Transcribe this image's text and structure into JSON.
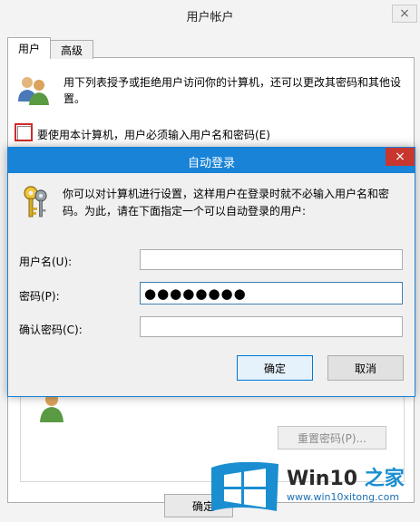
{
  "background_window": {
    "title": "用户帐户",
    "close_glyph": "×",
    "tabs": [
      {
        "label": "用户",
        "active": true
      },
      {
        "label": "高级",
        "active": false
      }
    ],
    "description": "用下列表授予或拒绝用户访问你的计算机，还可以更改其密码和其他设置。",
    "must_enter_checkbox": {
      "label": "要使用本计算机，用户必须输入用户名和密码(E)",
      "checked": false
    },
    "reset_password_label": "重置密码(P)...",
    "ok_label": "确定"
  },
  "dialog": {
    "title": "自动登录",
    "close_glyph": "×",
    "description": "你可以对计算机进行设置，这样用户在登录时就不必输入用户名和密码。为此，请在下面指定一个可以自动登录的用户:",
    "fields": {
      "username": {
        "label": "用户名(U):",
        "value": ""
      },
      "password": {
        "label": "密码(P):",
        "value": "●●●●●●●●"
      },
      "confirm": {
        "label": "确认密码(C):",
        "value": ""
      }
    },
    "ok_label": "确定",
    "cancel_label": "取消"
  },
  "watermark": {
    "brand_prefix": "Win10 ",
    "brand_suffix": "之家",
    "url": "www.win10xitong.com"
  },
  "colors": {
    "dialog_accent": "#1883d7",
    "close_red": "#c7372f",
    "highlight_red": "#d02a2a"
  }
}
